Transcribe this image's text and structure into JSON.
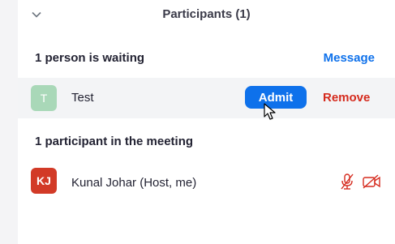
{
  "header": {
    "title": "Participants (1)",
    "collapse_icon": "chevron-down-icon"
  },
  "waiting": {
    "label": "1 person is waiting",
    "message_label": "Message",
    "entries": [
      {
        "initial": "T",
        "name": "Test",
        "admit_label": "Admit",
        "remove_label": "Remove",
        "avatar_color": "#a9d8b8"
      }
    ]
  },
  "meeting": {
    "label": "1 participant in the meeting",
    "participants": [
      {
        "initials": "KJ",
        "name": "Kunal Johar (Host, me)",
        "avatar_color": "#d23a27",
        "mic_icon": "mic-muted-icon",
        "video_icon": "video-off-icon"
      }
    ]
  },
  "colors": {
    "accent": "#0e71eb",
    "danger": "#d52b1e",
    "muted_icon": "#d52b1e"
  },
  "cursor_icon": "mouse-pointer-icon"
}
